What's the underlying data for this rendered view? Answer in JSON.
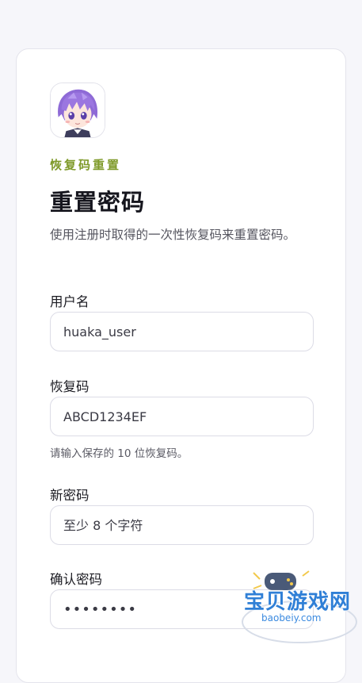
{
  "form": {
    "eyebrow": "恢复码重置",
    "title": "重置密码",
    "description": "使用注册时取得的一次性恢复码来重置密码。",
    "username": {
      "label": "用户名",
      "value": "huaka_user"
    },
    "recovery_code": {
      "label": "恢复码",
      "value": "ABCD1234EF",
      "hint": "请输入保存的 10 位恢复码。"
    },
    "new_password": {
      "label": "新密码",
      "placeholder": "至少 8 个字符"
    },
    "confirm_password": {
      "label": "确认密码",
      "value": "••••••••"
    }
  },
  "watermark": {
    "name": "宝贝游戏网",
    "url": "baobeiy.com"
  },
  "colors": {
    "accent": "#7f9a2a",
    "background": "#f6f6fa",
    "card": "#ffffff",
    "border": "#dcdce6"
  }
}
